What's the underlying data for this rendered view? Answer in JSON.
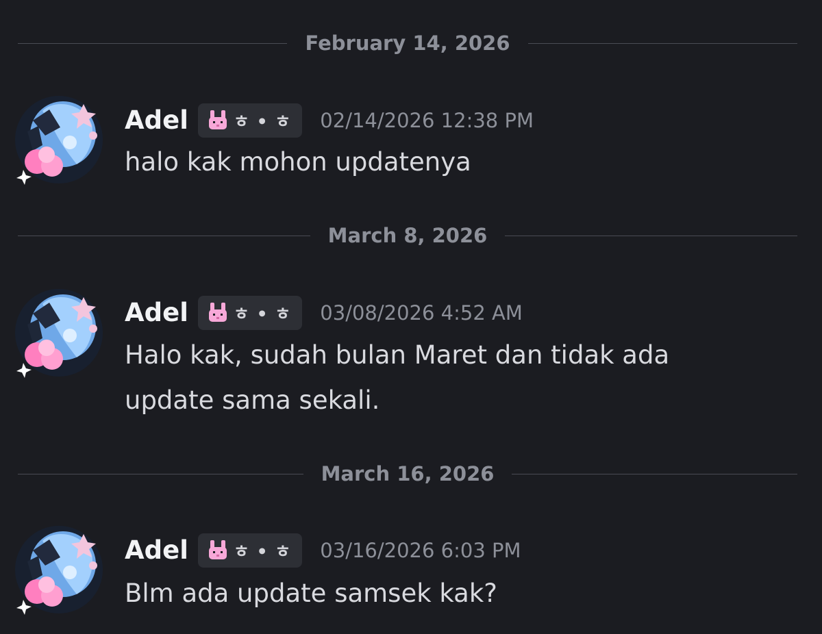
{
  "messages_group": [
    {
      "date": "February 14, 2026",
      "author": "Adel",
      "tag": "ㅎ • ㅎ",
      "timestamp": "02/14/2026 12:38 PM",
      "text": "halo kak mohon updatenya"
    },
    {
      "date": "March 8, 2026",
      "author": "Adel",
      "tag": "ㅎ • ㅎ",
      "timestamp": "03/08/2026 4:52 AM",
      "text": "Halo kak, sudah bulan Maret dan tidak ada update sama sekali."
    },
    {
      "date": "March 16, 2026",
      "author": "Adel",
      "tag": "ㅎ • ㅎ",
      "timestamp": "03/16/2026 6:03 PM",
      "text": "Blm ada update samsek kak?"
    }
  ],
  "icons": {
    "avatar": "anime-avatar-icon",
    "tag_icon": "bunny-icon"
  },
  "colors": {
    "background": "#1b1c21",
    "username": "#f2f3f5",
    "muted": "#8d9099",
    "message_text": "#d9dadf",
    "tag_background": "#2d2f35",
    "bunny": "#f7a8d8"
  }
}
